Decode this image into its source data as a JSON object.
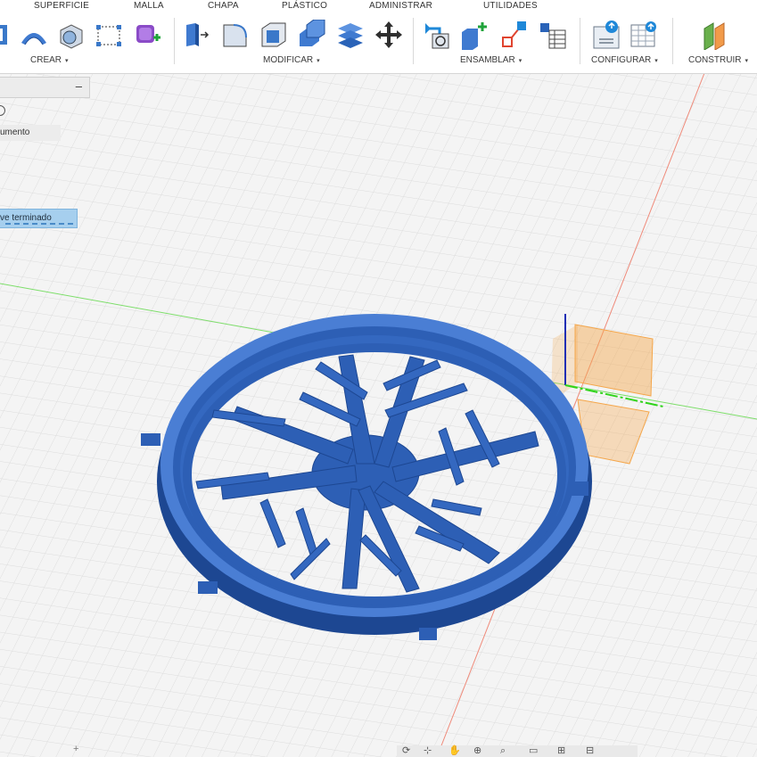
{
  "tabs": [
    "SUPERFICIE",
    "MALLA",
    "CHAPA",
    "PLÁSTICO",
    "ADMINISTRAR",
    "UTILIDADES"
  ],
  "groups": {
    "crear": "CREAR",
    "modificar": "MODIFICAR",
    "ensamblar": "ENSAMBLAR",
    "configurar": "CONFIGURAR",
    "construir": "CONSTRUIR"
  },
  "caret": "▾",
  "browser": {
    "collapse_symbol": "–",
    "row_text": "umento"
  },
  "status_pill": "ve terminado",
  "bottom_mark": "+",
  "navbar_icons": [
    "orbit-icon",
    "pan-icon",
    "hand-icon",
    "zoom-icon",
    "zoom-window-icon",
    "display-settings-icon",
    "grid-icon",
    "viewports-icon"
  ],
  "colors": {
    "model": "#2d5fb5",
    "model_light": "#4a7ed4",
    "model_dark": "#1d4792",
    "axis_x": "#e0442f",
    "axis_y": "#5fd44a",
    "axis_z": "#1d2fb5",
    "plane": "#f5a64a",
    "grid": "#d6d6d6",
    "status_bg": "#a6cfee"
  }
}
